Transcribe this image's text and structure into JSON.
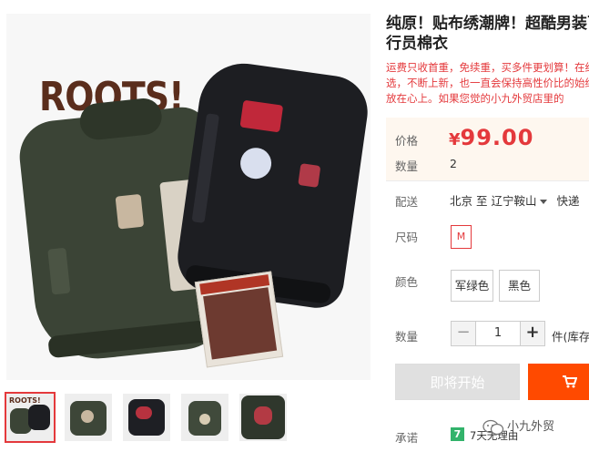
{
  "gallery": {
    "brand_text": "ROOTS!",
    "thumbnails": [
      {
        "label": "ROOTS!",
        "active": true
      },
      {
        "label": "",
        "active": false
      },
      {
        "label": "",
        "active": false
      },
      {
        "label": "",
        "active": false
      },
      {
        "label": "",
        "active": false
      }
    ]
  },
  "product": {
    "title": "纯原！贴布绣潮牌！超酷男装飞行员棉衣",
    "description": "运费只收首重，免续重，买多件更划算！在细选，不断上新，也一直会保持高性价比的始终放在心上。如果您觉的小九外贸店里的"
  },
  "price": {
    "label": "价格",
    "currency": "¥",
    "value": "99.00"
  },
  "quantity_sold": {
    "label": "数量",
    "value": "2"
  },
  "shipping": {
    "label": "配送",
    "from": "北京 至",
    "to": "辽宁鞍山",
    "method": "快递"
  },
  "size": {
    "label": "尺码",
    "options": [
      "M"
    ]
  },
  "color": {
    "label": "颜色",
    "options": [
      "军绿色",
      "黑色"
    ]
  },
  "quantity": {
    "label": "数量",
    "minus": "−",
    "value": "1",
    "plus": "+",
    "unit_text": "件(库存"
  },
  "actions": {
    "buy_now": "即将开始"
  },
  "promise": {
    "label": "承诺",
    "badge": "7",
    "text": "7天无理由"
  },
  "watermark": {
    "text": "小九外贸"
  },
  "colors": {
    "accent": "#e4393c",
    "cart": "#ff4a00",
    "price_bg": "#fef7ef",
    "badge_green": "#32b36b"
  }
}
